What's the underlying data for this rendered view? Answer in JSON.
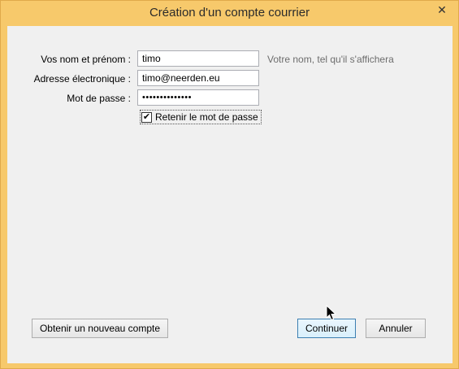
{
  "window": {
    "title": "Création d'un compte courrier",
    "close_glyph": "✕"
  },
  "form": {
    "name_label": "Vos nom et prénom :",
    "name_value": "timo",
    "name_hint": "Votre nom, tel qu'il s'affichera",
    "email_label": "Adresse électronique :",
    "email_value": "timo@neerden.eu",
    "password_label": "Mot de passe :",
    "password_value": "••••••••••••••",
    "remember_label": "Retenir le mot de passe",
    "remember_checked_glyph": "✔"
  },
  "buttons": {
    "new_account": "Obtenir un nouveau compte",
    "continue": "Continuer",
    "cancel": "Annuler"
  }
}
